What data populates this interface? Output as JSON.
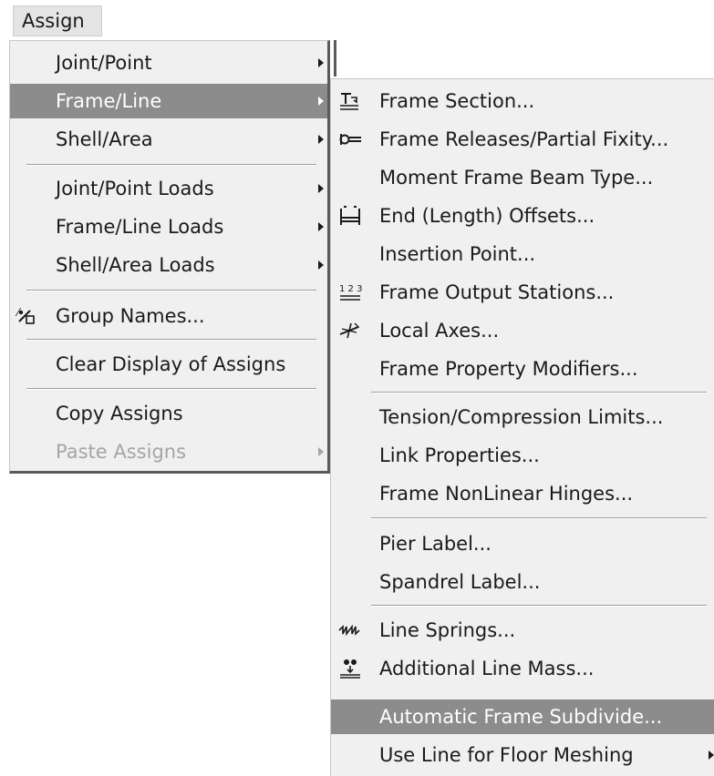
{
  "menubar": {
    "assign_label": "Assign"
  },
  "main_menu": {
    "items": [
      {
        "label": "Joint/Point",
        "submenu": true
      },
      {
        "label": "Frame/Line",
        "submenu": true
      },
      {
        "label": "Shell/Area",
        "submenu": true
      },
      {
        "label": "Joint/Point Loads",
        "submenu": true
      },
      {
        "label": "Frame/Line Loads",
        "submenu": true
      },
      {
        "label": "Shell/Area Loads",
        "submenu": true
      },
      {
        "label": "Group Names...",
        "icon": "group-names-icon"
      },
      {
        "label": "Clear Display of Assigns"
      },
      {
        "label": "Copy Assigns"
      },
      {
        "label": "Paste Assigns",
        "disabled": true,
        "submenu": true
      }
    ]
  },
  "sub_menu": {
    "items": [
      {
        "label": "Frame Section...",
        "icon": "frame-section-icon"
      },
      {
        "label": "Frame Releases/Partial Fixity...",
        "icon": "frame-releases-icon"
      },
      {
        "label": "Moment Frame Beam Type..."
      },
      {
        "label": "End (Length) Offsets...",
        "icon": "end-offsets-icon"
      },
      {
        "label": "Insertion Point..."
      },
      {
        "label": "Frame Output Stations...",
        "icon": "output-stations-icon"
      },
      {
        "label": "Local Axes...",
        "icon": "local-axes-icon"
      },
      {
        "label": "Frame Property Modifiers..."
      },
      {
        "label": "Tension/Compression Limits..."
      },
      {
        "label": "Link Properties..."
      },
      {
        "label": "Frame NonLinear Hinges..."
      },
      {
        "label": "Pier Label..."
      },
      {
        "label": "Spandrel Label..."
      },
      {
        "label": "Line Springs...",
        "icon": "line-springs-icon"
      },
      {
        "label": "Additional Line Mass...",
        "icon": "line-mass-icon"
      },
      {
        "label": "Automatic Frame Subdivide...",
        "highlighted": true
      },
      {
        "label": "Use Line for Floor Meshing",
        "submenu": true
      }
    ]
  },
  "colors": {
    "highlight": "#8c8c8c",
    "menu_bg": "#f0f0f0",
    "disabled_text": "#a5a5a5"
  }
}
